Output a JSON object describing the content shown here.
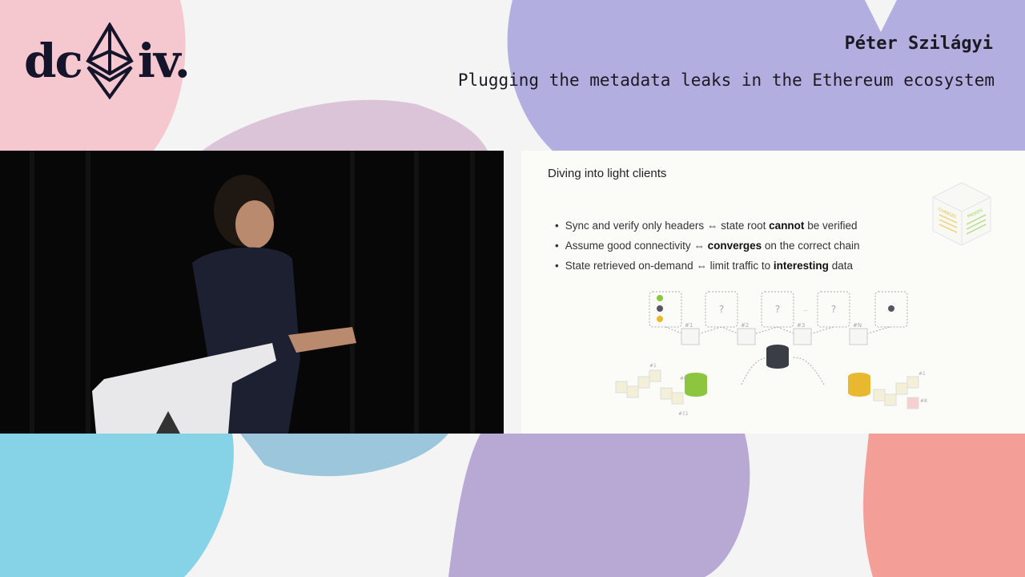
{
  "event": {
    "logo_left": "dc",
    "logo_right": "iv.",
    "logo_icon": "ethereum-diamond-icon"
  },
  "header": {
    "speaker": "Péter Szilágyi",
    "talk_title": "Plugging the metadata leaks in the Ethereum ecosystem"
  },
  "slide": {
    "title": "Diving into light clients",
    "bullets": [
      {
        "pre": "Sync and verify only headers",
        "arrow": "⇔",
        "mid": "state root",
        "bold": "cannot",
        "post": "be verified"
      },
      {
        "pre": "Assume good connectivity",
        "arrow": "⇔",
        "mid": "",
        "bold": "converges",
        "post": "on the correct chain"
      },
      {
        "pre": "State retrieved on-demand",
        "arrow": "⇔",
        "mid": "limit traffic to",
        "bold": "interesting",
        "post": "data"
      }
    ],
    "cube_labels": {
      "left": "CHANGES",
      "right": "PROOFS"
    },
    "diagram": {
      "unknown": "?",
      "ellipsis": "..",
      "blocks": [
        "#1",
        "#2",
        "#3",
        "#N"
      ],
      "chain_labels_left": [
        "#1",
        "#8",
        "#11"
      ],
      "chain_labels_right": [
        "#1",
        "#8"
      ]
    }
  },
  "colors": {
    "pink": "#f4c6cf",
    "purple": "#a8a6e2",
    "blue": "#86d3e8",
    "salmon": "#f49e98",
    "green": "#8cc63f",
    "gold": "#e8b830"
  }
}
